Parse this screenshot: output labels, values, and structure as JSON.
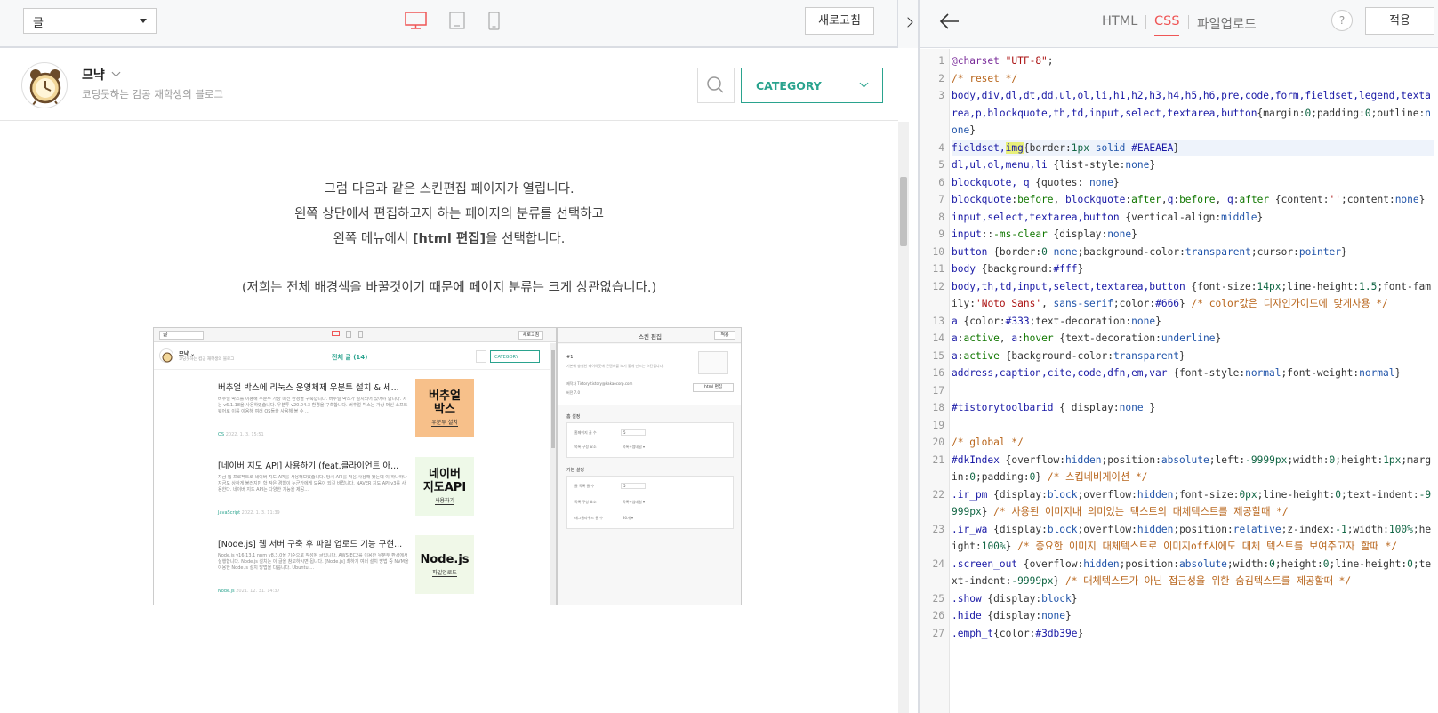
{
  "preview_toolbar": {
    "page_select_value": "글",
    "refresh_label": "새로고침"
  },
  "blog": {
    "name": "므냑",
    "description": "코딩뭇하는 컴공 재학생의 블로그",
    "category_label": "CATEGORY"
  },
  "article": {
    "lines": [
      "그럼 다음과 같은 스킨편집 페이지가 열립니다.",
      "왼쪽 상단에서 편집하고자 하는 페이지의 분류를 선택하고",
      "왼쪽 메뉴에서 [html 편집]을 선택합니다.",
      "(저희는 전체 배경색을 바꿀것이기 때문에 페이지 분류는 크게 상관없습니다.)"
    ],
    "line3_before": "왼쪽 메뉴에서 ",
    "line3_bold": "[html 편집]",
    "line3_after": "을 선택합니다."
  },
  "mini": {
    "select": "글",
    "refresh": "새로고침",
    "blog_name": "므냑 ⌄",
    "blog_desc": "코딩뭇하는 컴공 재학생의 블로그",
    "section_title": "전체 글 (14)",
    "category": "CATEGORY",
    "posts": [
      {
        "title": "버추얼 박스에 리눅스 운영체제 우분투 설치 & 세...",
        "excerpt": "버추얼 박스를 이용해 우분투 가상 머신 환경을 구축합니다. 버추얼 박스가 설치되어 있어야 합니다. 저는 v6.1.18을 사용하였습니다. 우분투 v20.04.3 환경을 구축합니다. 버추얼 박스는 가상 머신 소프트웨어로 이를 이용해 여러 OS들을 사용해 볼 수 ...",
        "category": "OS",
        "date": "2022. 1. 3. 15:51",
        "thumb_main": "버추얼\n박스",
        "thumb_sub": "우분투 설치"
      },
      {
        "title": "[네이버 지도 API] 사용하기 (feat.클라이언트 아...",
        "excerpt": "지금 웹 프로젝트로 네이버 지도 API를 사용해보았습니다. 당시 API를 처음 사용해 봤는데 이 하나하나 지금도 상하게 불러지만 학 작은 경험이 누군가에게 도움이 되길 바랍니다. NAVER 지도 API v3를 사용한다. 네이버 지도 API는 다양한 기능을 제공...",
        "category": "JavaScript",
        "date": "2022. 1. 3. 11:39",
        "thumb_main": "네이버\n지도API",
        "thumb_sub": "사용하기"
      },
      {
        "title": "[Node.js] 웹 서버 구축 후 파일 업로드 기능 구현...",
        "excerpt": "Node.js v16.13.1 npm v8.3.0을 기준으로 작성된 글입니다. AWS EC2를 이용한 우분투 환경에서 실행합니다. Node.js 설치는 이 글을 참고하시면 됩니다. [Node.js] 최하기 여러 설치 방법 중 NVM을 이용한 Node.js 설치 방법을 다룹니다. Ubuntu ...",
        "category": "Node.js",
        "date": "2021. 12. 31. 14:37",
        "thumb_main": "Node.js",
        "thumb_sub": "파일업로드"
      }
    ],
    "skin_title": "스킨 편집",
    "apply": "적용",
    "skin_name": "#1",
    "skin_desc": "기본에 충실한 레이아웃에 콘텐츠를 보기 좋게 만드는 스킨입니다.",
    "html_edit": "html 편집",
    "skin_meta1": "제작자    Tistory  tistory@kakaocorp.com",
    "skin_meta2": "버전    7.0",
    "group1": "홈 설정",
    "g1_row1": "홈페이지 글 수",
    "g1_val1": "5",
    "g1_row2": "목록 구성 요소",
    "g1_val2": "목록+썸네일 ▾",
    "group2": "기본 설정",
    "g2_row1": "글 목록 글 수",
    "g2_val1": "5",
    "g2_row2": "목록 구성 요소",
    "g2_val2": "목록+썸네일 ▾",
    "g2_row3": "태그클라우드 글 수",
    "g2_val3": "30개 ▾"
  },
  "editor": {
    "tabs": [
      "HTML",
      "CSS",
      "파일업로드"
    ],
    "help": "?",
    "apply_label": "적용",
    "active_line": 4,
    "code_lines": [
      {
        "n": "1",
        "html": "<span class=\"kw\">@charset</span> <span class=\"str\">\"UTF-8\"</span>;"
      },
      {
        "n": "2",
        "html": "<span class=\"cm\">/* reset */</span>"
      },
      {
        "n": "3",
        "html": "<span class=\"sel\">body,div,dl,dt,dd,ul,ol,li,h1,h2,h3,h4,h5,h6,pre,code,form,fieldset,legend,textarea,p,blockquote,th,td,input,select,textarea,button</span>{<span class=\"pr\">margin</span>:<span class=\"num\">0</span>;<span class=\"pr\">padding</span>:<span class=\"num\">0</span>;<span class=\"pr\">outline</span>:<span class=\"va\">none</span>}"
      },
      {
        "n": "4",
        "hl": true,
        "html": "<span class=\"sel\">fieldset,<span class=\"mark\">img</span></span>{<span class=\"pr\">border</span>:<span class=\"num\">1px</span> <span class=\"va\">solid</span> <span class=\"sel\">#EAEAEA</span>}"
      },
      {
        "n": "5",
        "html": "<span class=\"sel\">dl,ul,ol,menu,li</span> {<span class=\"pr\">list-style</span>:<span class=\"va\">none</span>}"
      },
      {
        "n": "6",
        "html": "<span class=\"sel\">blockquote, q</span> {<span class=\"pr\">quotes</span>: <span class=\"va\">none</span>}"
      },
      {
        "n": "7",
        "html": "<span class=\"sel\">blockquote</span>:<span class=\"val\">before</span>, <span class=\"sel\">blockquote</span>:<span class=\"val\">after</span>,<span class=\"sel\">q</span>:<span class=\"val\">before</span>, <span class=\"sel\">q</span>:<span class=\"val\">after</span> {<span class=\"pr\">content</span>:<span class=\"str\">''</span>;<span class=\"pr\">content</span>:<span class=\"va\">none</span>}"
      },
      {
        "n": "8",
        "html": "<span class=\"sel\">input,select,textarea,button</span> {<span class=\"pr\">vertical-align</span>:<span class=\"va\">middle</span>}"
      },
      {
        "n": "9",
        "html": "<span class=\"sel\">input</span>::<span class=\"val\">-ms-clear</span> {<span class=\"pr\">display</span>:<span class=\"va\">none</span>}"
      },
      {
        "n": "10",
        "html": "<span class=\"sel\">button</span> {<span class=\"pr\">border</span>:<span class=\"num\">0</span> <span class=\"va\">none</span>;<span class=\"pr\">background-color</span>:<span class=\"va\">transparent</span>;<span class=\"pr\">cursor</span>:<span class=\"va\">pointer</span>}"
      },
      {
        "n": "11",
        "html": "<span class=\"sel\">body</span> {<span class=\"pr\">background</span>:<span class=\"sel\">#fff</span>}"
      },
      {
        "n": "12",
        "html": "<span class=\"sel\">body,th,td,input,select,textarea,button</span> {<span class=\"pr\">font-size</span>:<span class=\"num\">14px</span>;<span class=\"pr\">line-height</span>:<span class=\"num\">1.5</span>;<span class=\"pr\">font-family</span>:<span class=\"str\">'Noto Sans'</span>, <span class=\"va\">sans-serif</span>;<span class=\"pr\">color</span>:<span class=\"sel\">#666</span>} <span class=\"cm\">/* color값은 디자인가이드에 맞게사용 */</span>"
      },
      {
        "n": "13",
        "html": "<span class=\"sel\">a</span> {<span class=\"pr\">color</span>:<span class=\"sel\">#333</span>;<span class=\"pr\">text-decoration</span>:<span class=\"va\">none</span>}"
      },
      {
        "n": "14",
        "html": "<span class=\"sel\">a</span>:<span class=\"val\">active</span>, <span class=\"sel\">a</span>:<span class=\"val\">hover</span> {<span class=\"pr\">text-decoration</span>:<span class=\"va\">underline</span>}"
      },
      {
        "n": "15",
        "html": "<span class=\"sel\">a</span>:<span class=\"val\">active</span> {<span class=\"pr\">background-color</span>:<span class=\"va\">transparent</span>}"
      },
      {
        "n": "16",
        "html": "<span class=\"sel\">address,caption,cite,code,dfn,em,var</span> {<span class=\"pr\">font-style</span>:<span class=\"va\">normal</span>;<span class=\"pr\">font-weight</span>:<span class=\"va\">normal</span>}"
      },
      {
        "n": "17",
        "html": " "
      },
      {
        "n": "18",
        "html": "<span class=\"sel\">#tistorytoolbarid</span> { <span class=\"pr\">display</span>:<span class=\"va\">none</span> }"
      },
      {
        "n": "19",
        "html": " "
      },
      {
        "n": "20",
        "html": "<span class=\"cm\">/* global */</span>"
      },
      {
        "n": "21",
        "html": "<span class=\"sel\">#dkIndex</span> {<span class=\"pr\">overflow</span>:<span class=\"va\">hidden</span>;<span class=\"pr\">position</span>:<span class=\"va\">absolute</span>;<span class=\"pr\">left</span>:<span class=\"num\">-9999px</span>;<span class=\"pr\">width</span>:<span class=\"num\">0</span>;<span class=\"pr\">height</span>:<span class=\"num\">1px</span>;<span class=\"pr\">margin</span>:<span class=\"num\">0</span>;<span class=\"pr\">padding</span>:<span class=\"num\">0</span>} <span class=\"cm\">/* 스킵네비게이션 */</span>"
      },
      {
        "n": "22",
        "html": "<span class=\"sel\">.ir_pm</span> {<span class=\"pr\">display</span>:<span class=\"va\">block</span>;<span class=\"pr\">overflow</span>:<span class=\"va\">hidden</span>;<span class=\"pr\">font-size</span>:<span class=\"num\">0px</span>;<span class=\"pr\">line-height</span>:<span class=\"num\">0</span>;<span class=\"pr\">text-indent</span>:<span class=\"num\">-9999px</span>} <span class=\"cm\">/* 사용된 이미지내 의미있는 텍스트의 대체텍스트를 제공할때 */</span>"
      },
      {
        "n": "23",
        "html": "<span class=\"sel\">.ir_wa</span> {<span class=\"pr\">display</span>:<span class=\"va\">block</span>;<span class=\"pr\">overflow</span>:<span class=\"va\">hidden</span>;<span class=\"pr\">position</span>:<span class=\"va\">relative</span>;<span class=\"pr\">z-index</span>:<span class=\"num\">-1</span>;<span class=\"pr\">width</span>:<span class=\"num\">100%</span>;<span class=\"pr\">height</span>:<span class=\"num\">100%</span>} <span class=\"cm\">/* 중요한 이미지 대체텍스트로 이미지off시에도 대체 텍스트를 보여주고자 할때 */</span>"
      },
      {
        "n": "24",
        "html": "<span class=\"sel\">.screen_out</span> {<span class=\"pr\">overflow</span>:<span class=\"va\">hidden</span>;<span class=\"pr\">position</span>:<span class=\"va\">absolute</span>;<span class=\"pr\">width</span>:<span class=\"num\">0</span>;<span class=\"pr\">height</span>:<span class=\"num\">0</span>;<span class=\"pr\">line-height</span>:<span class=\"num\">0</span>;<span class=\"pr\">text-indent</span>:<span class=\"num\">-9999px</span>} <span class=\"cm\">/* 대체텍스트가 아닌 접근성을 위한 숨김텍스트를 제공할때 */</span>"
      },
      {
        "n": "25",
        "html": "<span class=\"sel\">.show</span> {<span class=\"pr\">display</span>:<span class=\"va\">block</span>}"
      },
      {
        "n": "26",
        "html": "<span class=\"sel\">.hide</span> {<span class=\"pr\">display</span>:<span class=\"va\">none</span>}"
      },
      {
        "n": "27",
        "html": "<span class=\"sel\">.emph_t</span>{<span class=\"pr\">color</span>:<span class=\"sel\">#3db39e</span>}"
      }
    ]
  },
  "colors": {
    "accent_red": "#ef5656",
    "teal": "#2aa38e"
  }
}
